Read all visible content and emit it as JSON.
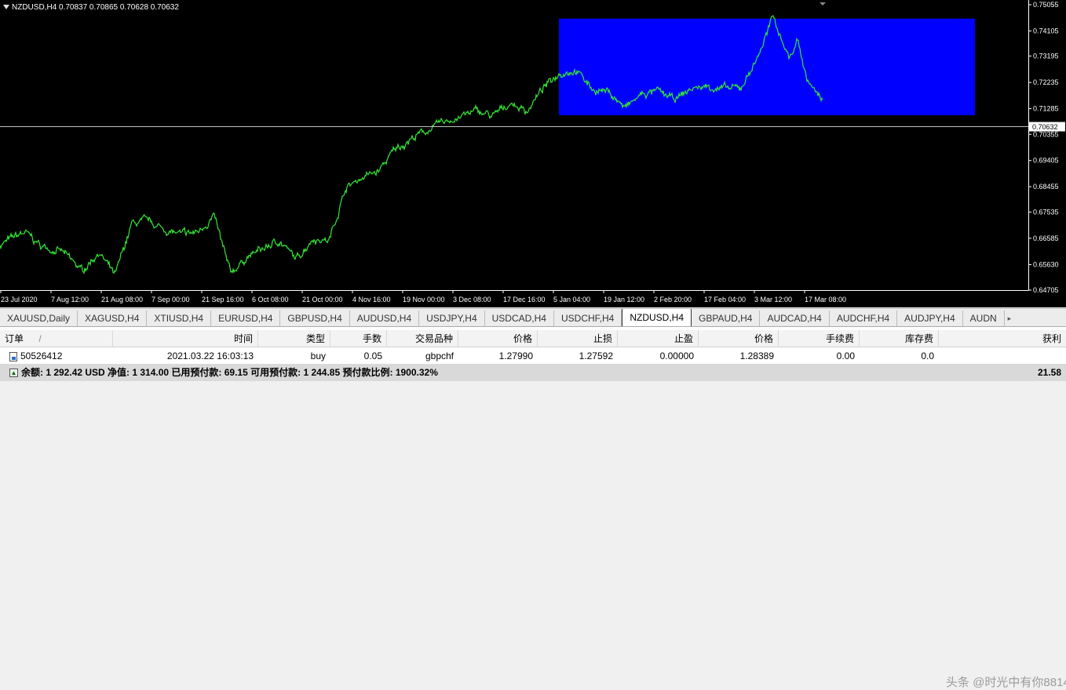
{
  "chart": {
    "symbol_info": "NZDUSD,H4  0.70837 0.70865 0.70628 0.70632",
    "current_price_label": "0.70632",
    "colors": {
      "background": "#000000",
      "price_line": "#33e633",
      "rectangle": "#0000ff",
      "axis_text": "#ffffff",
      "current_line": "#c0c0c0"
    }
  },
  "chart_data": {
    "type": "line",
    "x_tick_labels": [
      "23 Jul 2020",
      "7 Aug 12:00",
      "21 Aug 08:00",
      "7 Sep 00:00",
      "21 Sep 16:00",
      "6 Oct 08:00",
      "21 Oct 00:00",
      "4 Nov 16:00",
      "19 Nov 00:00",
      "3 Dec 08:00",
      "17 Dec 16:00",
      "5 Jan 04:00",
      "19 Jan 12:00",
      "2 Feb 20:00",
      "17 Feb 04:00",
      "3 Mar 12:00",
      "17 Mar 08:00"
    ],
    "y_tick_labels": [
      "0.75055",
      "0.74105",
      "0.73195",
      "0.72235",
      "0.71285",
      "0.70355",
      "0.69405",
      "0.68455",
      "0.67535",
      "0.66585",
      "0.65630",
      "0.64705"
    ],
    "ylim": [
      0.64705,
      0.75055
    ],
    "current_price": 0.70632,
    "rectangle": {
      "y_top": 0.7455,
      "y_bottom": 0.7105,
      "x_start_label": "5 Jan 04:00"
    },
    "series": [
      {
        "x": [
          0,
          0.03,
          0.05,
          0.075,
          0.1,
          0.12,
          0.14,
          0.16,
          0.18,
          0.2,
          0.22,
          0.24,
          0.26,
          0.28,
          0.3,
          0.32,
          0.34,
          0.36,
          0.38,
          0.4,
          0.42,
          0.44,
          0.46,
          0.48,
          0.5,
          0.52,
          0.54,
          0.56,
          0.58,
          0.6,
          0.62,
          0.64,
          0.66,
          0.68,
          0.7,
          0.72,
          0.74,
          0.76,
          0.78,
          0.8,
          0.82,
          0.84,
          0.86,
          0.88,
          0.9,
          0.92,
          0.94,
          0.96,
          0.97,
          0.98,
          1.0
        ],
        "values": [
          0.6635,
          0.668,
          0.663,
          0.661,
          0.654,
          0.661,
          0.652,
          0.671,
          0.672,
          0.669,
          0.667,
          0.668,
          0.674,
          0.653,
          0.659,
          0.662,
          0.665,
          0.658,
          0.666,
          0.665,
          0.684,
          0.688,
          0.69,
          0.698,
          0.702,
          0.705,
          0.708,
          0.71,
          0.712,
          0.71,
          0.715,
          0.712,
          0.72,
          0.726,
          0.727,
          0.72,
          0.719,
          0.713,
          0.718,
          0.719,
          0.716,
          0.72,
          0.721,
          0.72,
          0.72,
          0.731,
          0.746,
          0.731,
          0.738,
          0.724,
          0.715
        ]
      }
    ]
  },
  "tabs": [
    {
      "label": "XAUUSD,Daily"
    },
    {
      "label": "XAGUSD,H4"
    },
    {
      "label": "XTIUSD,H4"
    },
    {
      "label": "EURUSD,H4"
    },
    {
      "label": "GBPUSD,H4"
    },
    {
      "label": "AUDUSD,H4"
    },
    {
      "label": "USDJPY,H4"
    },
    {
      "label": "USDCAD,H4"
    },
    {
      "label": "USDCHF,H4"
    },
    {
      "label": "NZDUSD,H4"
    },
    {
      "label": "GBPAUD,H4"
    },
    {
      "label": "AUDCAD,H4"
    },
    {
      "label": "AUDCHF,H4"
    },
    {
      "label": "AUDJPY,H4"
    },
    {
      "label": "AUDN"
    }
  ],
  "active_tab": "NZDUSD,H4",
  "terminal": {
    "headers": {
      "order": "订单",
      "sort": "/",
      "time": "时间",
      "type": "类型",
      "lots": "手数",
      "symbol": "交易品种",
      "price": "价格",
      "sl": "止损",
      "tp": "止盈",
      "cur_price": "价格",
      "commission": "手续费",
      "swap": "库存费",
      "profit": "获利"
    },
    "row": {
      "order": "50526412",
      "time": "2021.03.22 16:03:13",
      "type": "buy",
      "lots": "0.05",
      "symbol": "gbpchf",
      "price": "1.27990",
      "sl": "1.27592",
      "tp": "0.00000",
      "cur_price": "1.28389",
      "commission": "0.00",
      "swap": "0.0",
      "profit": ""
    },
    "summary": {
      "text": "余额: 1 292.42 USD  净值: 1 314.00  已用预付款: 69.15  可用预付款: 1 244.85  预付款比例: 1900.32%",
      "profit": "21.58"
    }
  },
  "watermark": "头条 @时光中有你8814"
}
